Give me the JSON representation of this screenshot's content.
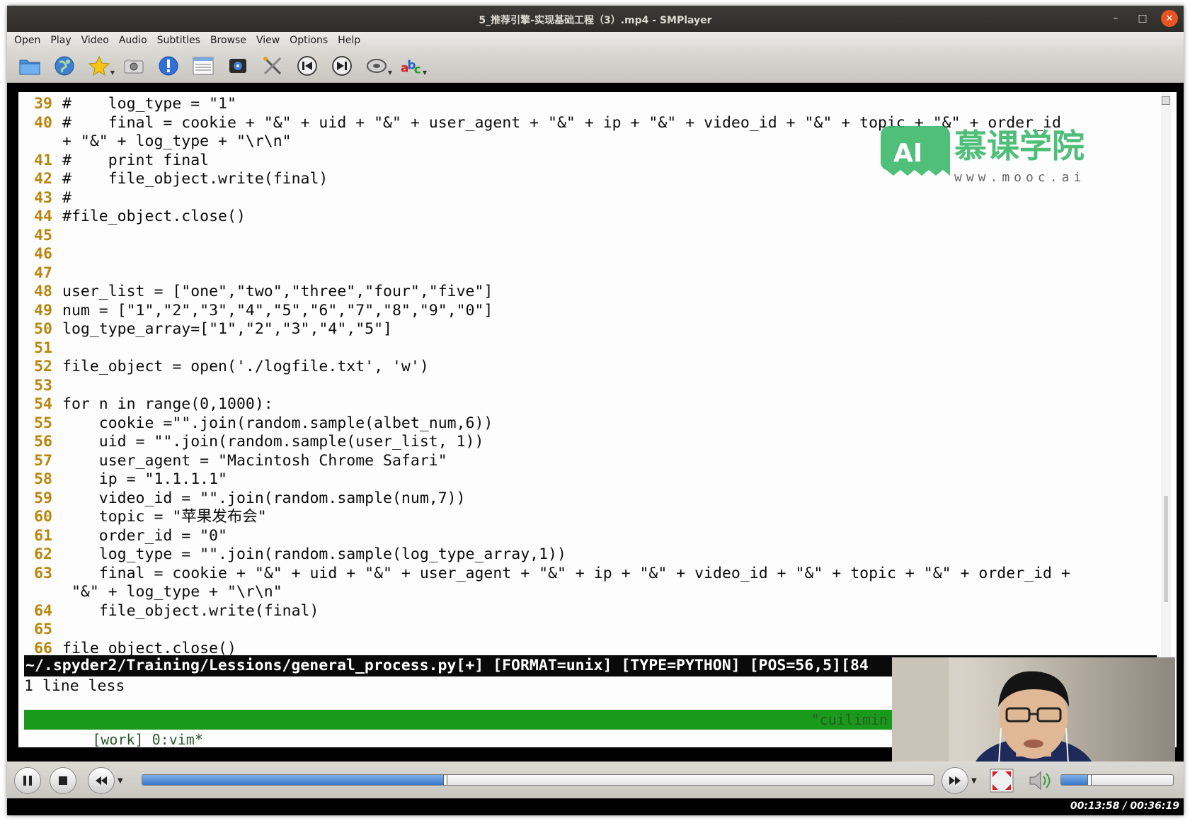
{
  "window": {
    "title": "5_推荐引擎-实现基础工程（3）.mp4 - SMPlayer",
    "minimize_label": "–",
    "maximize_label": "□",
    "close_label": "✕"
  },
  "menu": {
    "items": [
      {
        "label": "Open"
      },
      {
        "label": "Play"
      },
      {
        "label": "Video"
      },
      {
        "label": "Audio"
      },
      {
        "label": "Subtitles"
      },
      {
        "label": "Browse"
      },
      {
        "label": "View"
      },
      {
        "label": "Options"
      },
      {
        "label": "Help"
      }
    ]
  },
  "toolbar": {
    "icons": [
      "folder-icon",
      "globe-icon",
      "favorites-star-icon",
      "screenshot-camera-icon",
      "info-icon",
      "playlist-icon",
      "video-settings-icon",
      "tools-icon",
      "previous-icon",
      "next-icon",
      "disc-icon",
      "subtitles-abc-icon"
    ]
  },
  "editor": {
    "lines": [
      {
        "num": "39",
        "text": "#    log_type = \"1\""
      },
      {
        "num": "40",
        "text": "#    final = cookie + \"&\" + uid + \"&\" + user_agent + \"&\" + ip + \"&\" + video_id + \"&\" + topic + \"&\" + order_id"
      },
      {
        "num": "",
        "text": "+ \"&\" + log_type + \"\\r\\n\""
      },
      {
        "num": "41",
        "text": "#    print final"
      },
      {
        "num": "42",
        "text": "#    file_object.write(final)"
      },
      {
        "num": "43",
        "text": "#"
      },
      {
        "num": "44",
        "text": "#file_object.close()"
      },
      {
        "num": "45",
        "text": ""
      },
      {
        "num": "46",
        "text": ""
      },
      {
        "num": "47",
        "text": ""
      },
      {
        "num": "48",
        "text": "user_list = [\"one\",\"two\",\"three\",\"four\",\"five\"]"
      },
      {
        "num": "49",
        "text": "num = [\"1\",\"2\",\"3\",\"4\",\"5\",\"6\",\"7\",\"8\",\"9\",\"0\"]"
      },
      {
        "num": "50",
        "text": "log_type_array=[\"1\",\"2\",\"3\",\"4\",\"5\"]"
      },
      {
        "num": "51",
        "text": ""
      },
      {
        "num": "52",
        "text": "file_object = open('./logfile.txt', 'w')"
      },
      {
        "num": "53",
        "text": ""
      },
      {
        "num": "54",
        "text": "for n in range(0,1000):"
      },
      {
        "num": "55",
        "text": "    cookie =\"\".join(random.sample(albet_num,6))"
      },
      {
        "num": "56",
        "text": "    uid = \"\".join(random.sample(user_list, 1))"
      },
      {
        "num": "57",
        "text": "    user_agent = \"Macintosh Chrome Safari\""
      },
      {
        "num": "58",
        "text": "    ip = \"1.1.1.1\""
      },
      {
        "num": "59",
        "text": "    video_id = \"\".join(random.sample(num,7))"
      },
      {
        "num": "60",
        "text": "    topic = \"苹果发布会\""
      },
      {
        "num": "61",
        "text": "    order_id = \"0\""
      },
      {
        "num": "62",
        "text": "    log_type = \"\".join(random.sample(log_type_array,1))"
      },
      {
        "num": "63",
        "text": "    final = cookie + \"&\" + uid + \"&\" + user_agent + \"&\" + ip + \"&\" + video_id + \"&\" + topic + \"&\" + order_id +"
      },
      {
        "num": "",
        "text": " \"&\" + log_type + \"\\r\\n\""
      },
      {
        "num": "64",
        "text": "    file_object.write(final)"
      },
      {
        "num": "65",
        "text": ""
      },
      {
        "num": "66",
        "text": "file_object.close()"
      }
    ],
    "status_line": "~/.spyder2/Training/Lessions/general_process.py[+] [FORMAT=unix] [TYPE=PYTHON] [POS=56,5][84",
    "message_line": "1 line less",
    "tmux_left": "[work] 0:vim*",
    "tmux_right": "\"cuilimin"
  },
  "watermark": {
    "logo_text": "AI",
    "brand_text": "慕课学院",
    "url_text": "www.mooc.ai"
  },
  "playback": {
    "progress_fraction": 0.383,
    "volume_fraction": 0.25,
    "time_display": "00:13:58 / 00:36:19"
  }
}
